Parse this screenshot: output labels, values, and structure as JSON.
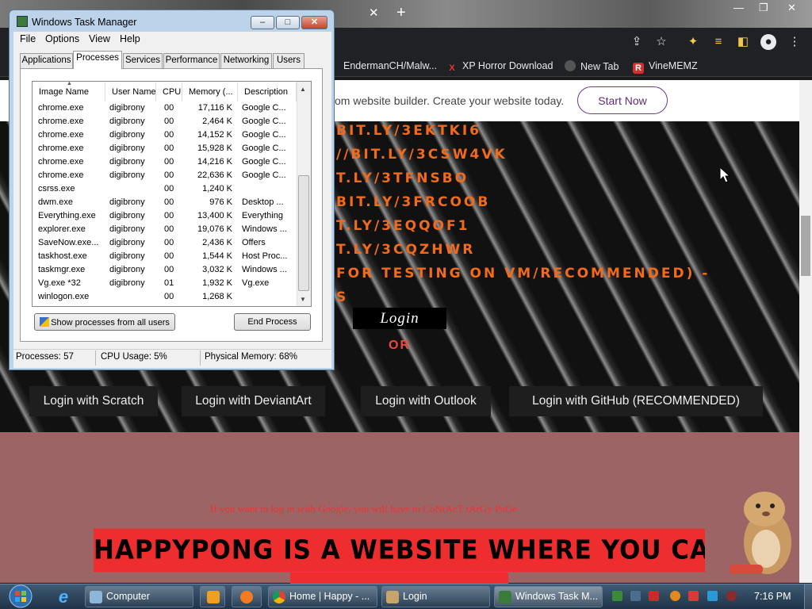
{
  "browser": {
    "bookmarks": [
      "EndermanCH/Malw...",
      "XP Horror Download",
      "New Tab",
      "VineMEMZ"
    ]
  },
  "page": {
    "ad_text": "om website builder. Create your website today.",
    "start_now": "Start Now",
    "hero_links": [
      "BIT.LY/3EKTKI6",
      "//BIT.LY/3CSW4VK",
      "T.LY/3TFNSBO",
      "BIT.LY/3FRCOOB",
      "T.LY/3EQQOF1",
      "T.LY/3CQZHWR",
      "FOR TESTING ON VM/RECOMMENDED) -",
      "S"
    ],
    "login_label": "Login",
    "or_label": "OR",
    "login_buttons": [
      "Login with Scratch",
      "Login with DeviantArt",
      "Login with Outlook",
      "Login with GitHub (RECOMMENDED)"
    ],
    "google_note": "If you want to log in with Google, you will have to CoNtAcT tArGy PaGe",
    "banner_text": "HAPPYPONG IS A WEBSITE WHERE YOU CAN PLAY PONG"
  },
  "task_manager": {
    "title": "Windows Task Manager",
    "menu": [
      "File",
      "Options",
      "View",
      "Help"
    ],
    "tabs": [
      "Applications",
      "Processes",
      "Services",
      "Performance",
      "Networking",
      "Users"
    ],
    "active_tab": "Processes",
    "columns": [
      "Image Name",
      "User Name",
      "CPU",
      "Memory (...",
      "Description"
    ],
    "processes": [
      {
        "image": "chrome.exe",
        "user": "digibrony",
        "cpu": "00",
        "mem": "17,116 K",
        "desc": "Google C..."
      },
      {
        "image": "chrome.exe",
        "user": "digibrony",
        "cpu": "00",
        "mem": "2,464 K",
        "desc": "Google C..."
      },
      {
        "image": "chrome.exe",
        "user": "digibrony",
        "cpu": "00",
        "mem": "14,152 K",
        "desc": "Google C..."
      },
      {
        "image": "chrome.exe",
        "user": "digibrony",
        "cpu": "00",
        "mem": "15,928 K",
        "desc": "Google C..."
      },
      {
        "image": "chrome.exe",
        "user": "digibrony",
        "cpu": "00",
        "mem": "14,216 K",
        "desc": "Google C..."
      },
      {
        "image": "chrome.exe",
        "user": "digibrony",
        "cpu": "00",
        "mem": "22,636 K",
        "desc": "Google C..."
      },
      {
        "image": "csrss.exe",
        "user": "",
        "cpu": "00",
        "mem": "1,240 K",
        "desc": ""
      },
      {
        "image": "dwm.exe",
        "user": "digibrony",
        "cpu": "00",
        "mem": "976 K",
        "desc": "Desktop ..."
      },
      {
        "image": "Everything.exe",
        "user": "digibrony",
        "cpu": "00",
        "mem": "13,400 K",
        "desc": "Everything"
      },
      {
        "image": "explorer.exe",
        "user": "digibrony",
        "cpu": "00",
        "mem": "19,076 K",
        "desc": "Windows ..."
      },
      {
        "image": "SaveNow.exe...",
        "user": "digibrony",
        "cpu": "00",
        "mem": "2,436 K",
        "desc": "Offers"
      },
      {
        "image": "taskhost.exe",
        "user": "digibrony",
        "cpu": "00",
        "mem": "1,544 K",
        "desc": "Host Proc..."
      },
      {
        "image": "taskmgr.exe",
        "user": "digibrony",
        "cpu": "00",
        "mem": "3,032 K",
        "desc": "Windows ..."
      },
      {
        "image": "Vg.exe *32",
        "user": "digibrony",
        "cpu": "01",
        "mem": "1,932 K",
        "desc": "Vg.exe"
      },
      {
        "image": "winlogon.exe",
        "user": "",
        "cpu": "00",
        "mem": "1,268 K",
        "desc": ""
      }
    ],
    "show_all_button": "Show processes from all users",
    "end_process_button": "End Process",
    "status": {
      "processes": "Processes: 57",
      "cpu": "CPU Usage: 5%",
      "memory": "Physical Memory: 68%"
    },
    "title_buttons": {
      "minimize": "–",
      "maximize": "□",
      "close": "✕"
    }
  },
  "taskbar": {
    "items": [
      "Computer",
      "Home | Happy - ...",
      "Login",
      "Windows Task M..."
    ],
    "clock": "7:16 PM"
  },
  "colors": {
    "hero_link": "#f26a1b",
    "banner": "#ee2e2e",
    "accent": "#6f3a8f"
  }
}
